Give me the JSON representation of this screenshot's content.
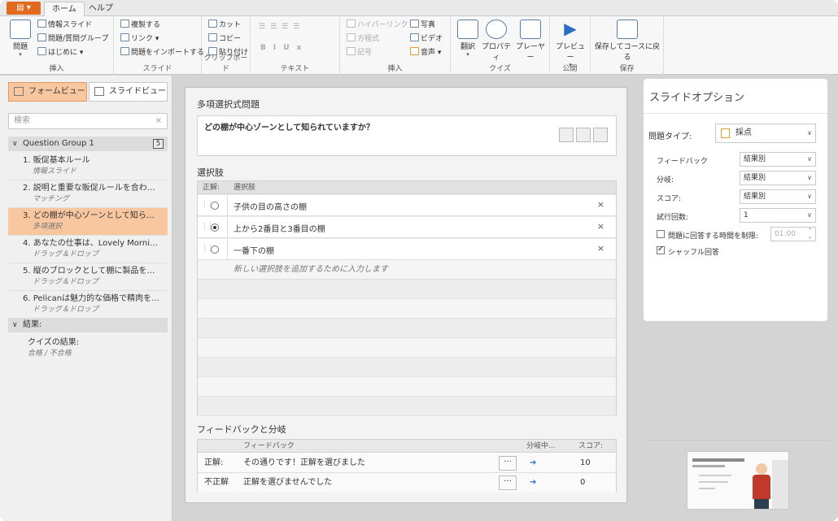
{
  "ribbon": {
    "file_label": "▤ ▾",
    "tabs": [
      "ホーム",
      "ヘルプ"
    ],
    "insert_group": {
      "new_slide": "問題",
      "info_slide": "情報スライド",
      "question_group": "問題/質問グループ",
      "intro": "はじめに",
      "label": "挿入"
    },
    "slide_group": {
      "duplicate": "複製する",
      "link": "リンク",
      "import": "問題をインポートする",
      "label": "スライド"
    },
    "clipboard_group": {
      "cut": "カット",
      "copy": "コピー",
      "paste": "貼り付け",
      "label": "クリップボード"
    },
    "text_group": {
      "label": "テキスト"
    },
    "insert2_group": {
      "hyperlink": "ハイパーリンク",
      "equation": "方程式",
      "symbol": "記号",
      "photo": "写真",
      "video": "ビデオ",
      "audio": "音声",
      "label": "挿入"
    },
    "quiz_group": {
      "translate": "翻訳",
      "properties": "プロパティ",
      "player": "プレーヤー",
      "label": "クイズ"
    },
    "publish_group": {
      "preview": "プレビュー",
      "label": "公開"
    },
    "save_group": {
      "save_return": "保存してコースに戻る",
      "label": "保存"
    }
  },
  "left": {
    "form_view": "フォームビュー",
    "slide_view": "スライドビュー",
    "search_placeholder": "検索",
    "group_name": "Question Group 1",
    "group_count": "5",
    "slides": [
      {
        "title": "1. 販促基本ルール",
        "type": "情報スライド"
      },
      {
        "title": "2. 説明と重要な販促ルールを合わ…",
        "type": "マッチング"
      },
      {
        "title": "3. どの棚が中心ゾーンとして知ら…",
        "type": "多項選択"
      },
      {
        "title": "4. あなたの仕事は、Lovely Morni…",
        "type": "ドラッグ＆ドロップ"
      },
      {
        "title": "5. 縦のブロックとして棚に製品を…",
        "type": "ドラッグ＆ドロップ"
      },
      {
        "title": "6. Pelicanは魅力的な価格で精肉を…",
        "type": "ドラッグ＆ドロップ"
      }
    ],
    "results_header": "結果:",
    "result_title": "クイズの結果:",
    "result_sub": "合格 / 不合格"
  },
  "editor": {
    "question_type_title": "多項選択式問題",
    "question_text": "どの棚が中心ゾーンとして知られていますか？",
    "choices_title": "選択肢",
    "col_correct": "正解:",
    "col_choice": "選択肢",
    "choices": [
      {
        "text": "子供の目の高さの棚",
        "correct": false
      },
      {
        "text": "上から2番目と3番目の棚",
        "correct": true
      },
      {
        "text": "一番下の棚",
        "correct": false
      }
    ],
    "add_choice_placeholder": "新しい選択肢を追加するために入力します",
    "feedback_title": "フィードバックと分岐",
    "fb_col_feedback": "フィードバック",
    "fb_col_branch": "分岐中...",
    "fb_col_score": "スコア:",
    "feedback_rows": [
      {
        "label": "正解:",
        "text": "その通りです！正解を選びました",
        "score": "10"
      },
      {
        "label": "不正解",
        "text": "正解を選びませんでした",
        "score": "0"
      }
    ]
  },
  "options": {
    "title": "スライドオプション",
    "question_type_label": "問題タイプ:",
    "question_type_value": "採点",
    "rows": [
      {
        "label": "フィードバック",
        "value": "結果別"
      },
      {
        "label": "分岐:",
        "value": "結果別"
      },
      {
        "label": "スコア:",
        "value": "結果別"
      },
      {
        "label": "試行回数:",
        "value": "1"
      }
    ],
    "time_limit_label": "問題に回答する時間を制限:",
    "time_limit_value": "01:00",
    "shuffle_label": "シャッフル回答"
  },
  "colors": {
    "accent": "#e26a1f",
    "selected": "#f8c79f",
    "link_arrow": "#2a6fc4"
  }
}
